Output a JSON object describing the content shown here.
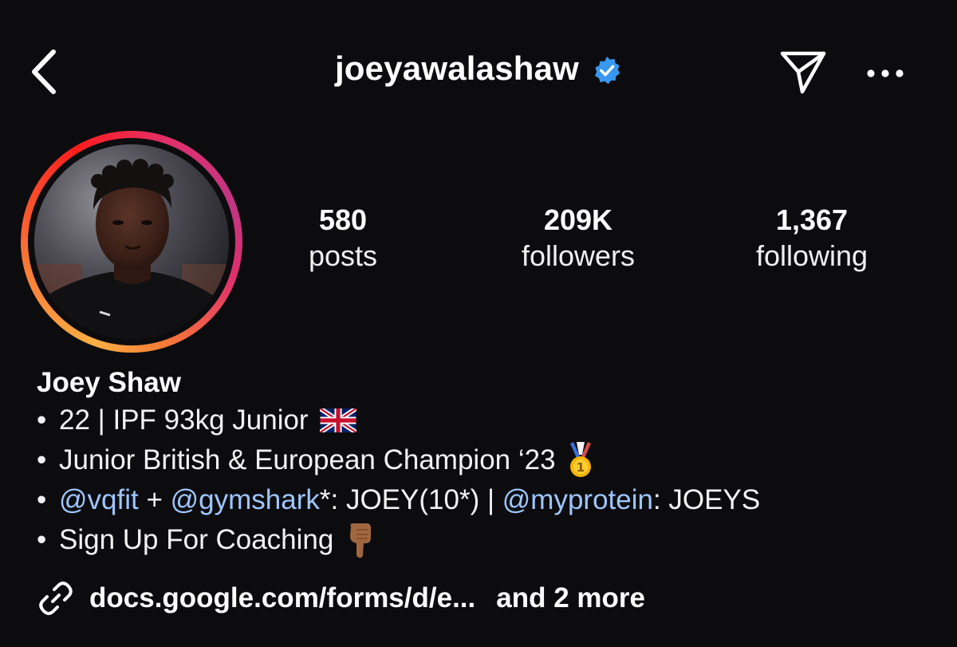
{
  "header": {
    "username": "joeyawalashaw",
    "verified": true,
    "accent_verified": "#3897f0",
    "icons": [
      "chevron-left-icon",
      "verified-badge-icon",
      "send-icon",
      "more-horizontal-icon"
    ]
  },
  "profile": {
    "avatar_ring_colors": [
      "#fcaf45",
      "#f77737",
      "#fd1d1d",
      "#e1306c",
      "#c13584"
    ],
    "stats": [
      {
        "value": "580",
        "label": "posts"
      },
      {
        "value": "209K",
        "label": "followers"
      },
      {
        "value": "1,367",
        "label": "following"
      }
    ]
  },
  "bio": {
    "name": "Joey Shaw",
    "bullet": "•",
    "line1": {
      "text": "22 | IPF 93kg Junior",
      "emoji": "uk-flag"
    },
    "line2": {
      "text": "Junior British & European Champion ‘23",
      "emoji": "gold-medal"
    },
    "line3": {
      "mention1": "@vqfit",
      "sep1": " + ",
      "mention2": "@gymshark",
      "text1": "*: JOEY(10*) | ",
      "mention3": "@myprotein",
      "text2": ": JOEYS"
    },
    "line4": {
      "text": "Sign Up For Coaching",
      "emoji": "pointing-down"
    }
  },
  "link": {
    "icon": "link-icon",
    "url_text": "docs.google.com/forms/d/e...",
    "more_text": "and 2 more"
  },
  "colors": {
    "background": "#0c0c0f",
    "text": "#ffffff",
    "mention": "#9ec6ff"
  }
}
